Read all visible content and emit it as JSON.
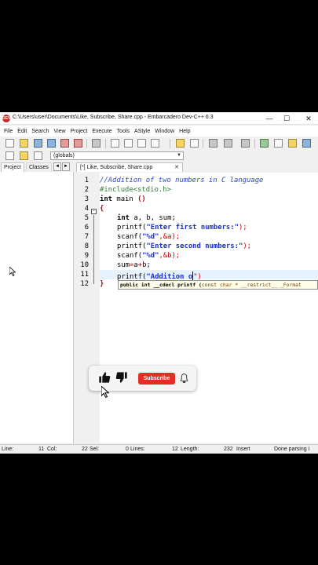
{
  "window": {
    "icon_text": "DEV",
    "title": "C:\\Users\\user\\Documents\\Like, Subscribe, Share.cpp - Embarcadero Dev-C++ 6.3",
    "minimize": "—",
    "maximize": "☐",
    "close": "✕"
  },
  "menu": [
    "File",
    "Edit",
    "Search",
    "View",
    "Project",
    "Execute",
    "Tools",
    "AStyle",
    "Window",
    "Help"
  ],
  "toolbar": {
    "globals_value": "(globals)"
  },
  "left_pane": {
    "tabs": [
      "Project",
      "Classes"
    ],
    "prev_arrow": "◄",
    "next_arrow": "►"
  },
  "editor_tab": {
    "label": "[*] Like, Subscribe, Share.cpp",
    "close": "✕"
  },
  "code": {
    "line_numbers": [
      "1",
      "2",
      "3",
      "4",
      "5",
      "6",
      "7",
      "8",
      "9",
      "10",
      "11",
      "12"
    ],
    "fold_open": "-",
    "fold_close": "}",
    "l1": "//Addition of two numbers in C language",
    "l2": "#include<stdio.h>",
    "l3_kw": "int",
    "l3_rest": " main ",
    "l3_paren": "()",
    "l4": "{",
    "l5_kw": "int",
    "l5_rest": " a, b, sum;",
    "l6_fn": "printf(",
    "l6_str": "\"Enter first numbers:\"",
    "l6_end": ");",
    "l7_fn": "scanf(",
    "l7_str": "\"%d\"",
    "l7_end": ",&a);",
    "l8_fn": "printf(",
    "l8_str": "\"Enter second numbers:\"",
    "l8_end": ");",
    "l9_fn": "scanf(",
    "l9_str": "\"%d\"",
    "l9_end": ",&b);",
    "l10_a": "sum",
    "l10_op1": "=",
    "l10_b": "a",
    "l10_op2": "+",
    "l10_c": "b;",
    "l11_fn": "printf(",
    "l11_str": "\"Addition o",
    "l11_end": "\")",
    "l12": "}"
  },
  "tooltip": {
    "part1": "public int __cdecl printf (",
    "part2": "const char * __restrict__ _Format"
  },
  "status": {
    "line_label": "Line:",
    "line_value": "11",
    "col_label": "Col:",
    "col_value": "22",
    "sel_label": "Sel:",
    "sel_value": "0",
    "lines_label": "Lines:",
    "lines_value": "12",
    "length_label": "Length:",
    "length_value": "232",
    "mode": "Insert",
    "message": "Done parsing i"
  },
  "subscribe": {
    "button_label": "Subscribe"
  }
}
